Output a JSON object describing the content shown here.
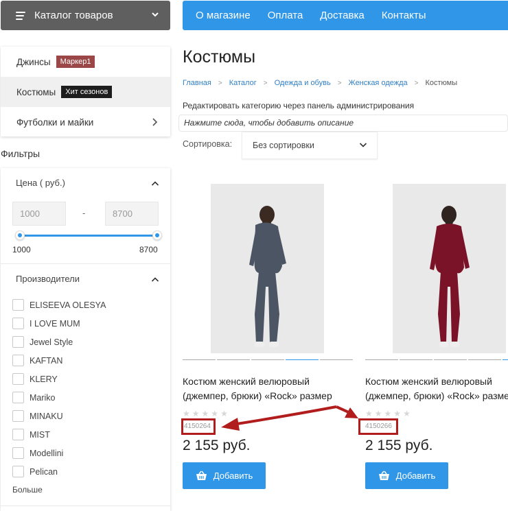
{
  "catalog": {
    "label": "Каталог товаров"
  },
  "topnav": {
    "items": [
      "О магазине",
      "Оплата",
      "Доставка",
      "Контакты"
    ]
  },
  "sidebar": {
    "items": [
      {
        "label": "Джинсы",
        "badge": "Маркер1",
        "badge_color": "#9b4747"
      },
      {
        "label": "Костюмы",
        "badge": "Хит сезонов",
        "badge_color": "#1d1d1d"
      },
      {
        "label": "Футболки и майки"
      }
    ]
  },
  "filters": {
    "title": "Фильтры",
    "price": {
      "label": "Цена ( руб.)",
      "min_value": "1000",
      "max_value": "8700",
      "dash": "-",
      "range_min": "1000",
      "range_max": "8700"
    },
    "brands": {
      "label": "Производители",
      "items": [
        "ELISEEVA OLESYA",
        "I LOVE MUM",
        "Jewel Style",
        "KAFTAN",
        "KLERY",
        "Mariko",
        "MINAKU",
        "MIST",
        "Modellini",
        "Pelican"
      ],
      "more": "Больше"
    }
  },
  "page": {
    "title": "Костюмы",
    "breadcrumb": [
      "Главная",
      "Каталог",
      "Одежда и обувь",
      "Женская одежда",
      "Костюмы"
    ],
    "edit_note": "Редактировать категорию через панель администрирования",
    "description_placeholder": "Нажмите сюда, чтобы добавить описание"
  },
  "sort": {
    "label": "Сортировка:",
    "value": "Без сортировки"
  },
  "products": [
    {
      "name": "Костюм женский велюровый (джемпер, брюки) «Rock» размер",
      "sku": "4150264",
      "price": "2 155 руб.",
      "add_label": "Добавить",
      "garment_color": "#4c5563"
    },
    {
      "name": "Костюм женский велюровый (джемпер, брюки) «Rock» размер",
      "sku": "4150266",
      "price": "2 155 руб.",
      "add_label": "Добавить",
      "garment_color": "#7a1228"
    }
  ],
  "colors": {
    "accent": "#2f96e8",
    "annotation": "#b11d1d"
  }
}
